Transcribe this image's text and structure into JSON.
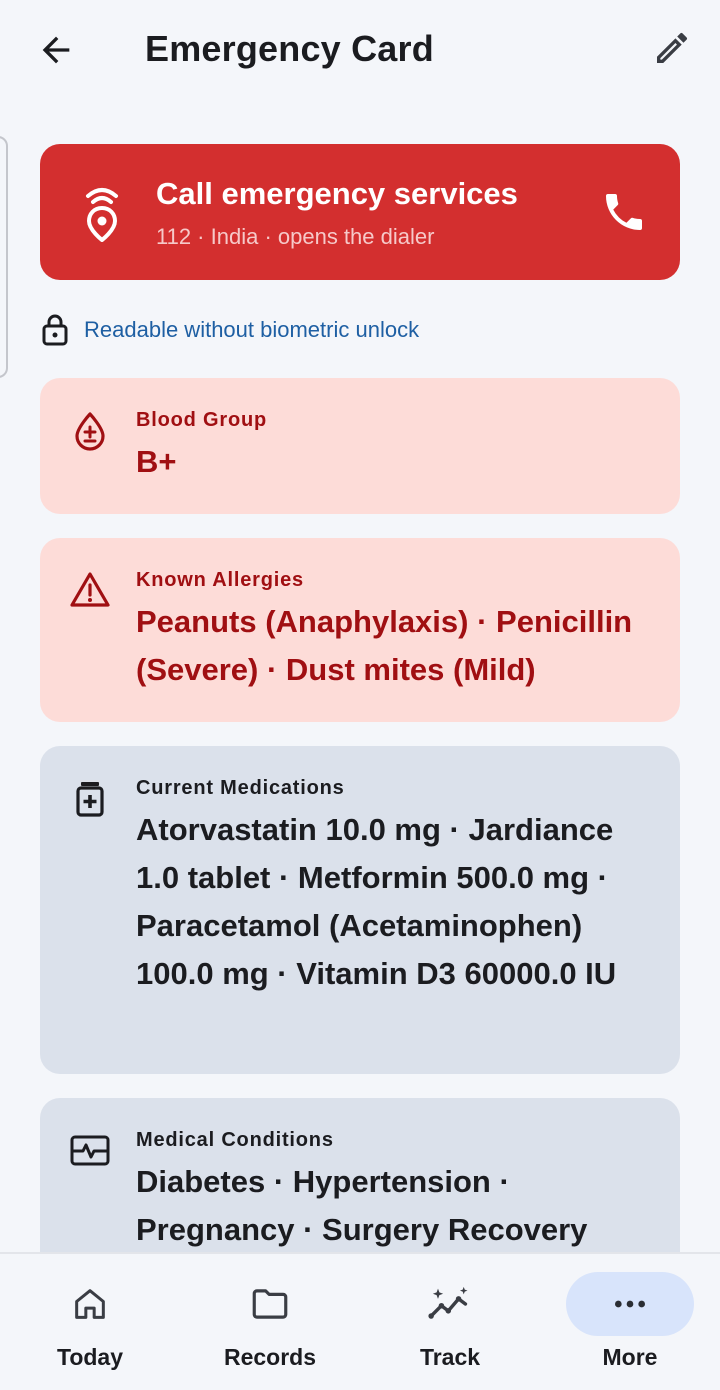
{
  "header": {
    "title": "Emergency Card"
  },
  "emergency_call": {
    "title": "Call emergency services",
    "subtitle": "112 · India · opens the dialer"
  },
  "notice": {
    "text": "Readable without biometric unlock"
  },
  "cards": {
    "blood_group": {
      "label": "Blood Group",
      "value": "B+"
    },
    "allergies": {
      "label": "Known Allergies",
      "value": "Peanuts (Anaphylaxis) · Penicillin (Severe) · Dust mites (Mild)"
    },
    "medications": {
      "label": "Current Medications",
      "value": "Atorvastatin 10.0 mg · Jardiance 1.0 tablet · Metformin 500.0 mg · Paracetamol (Acetaminophen) 100.0 mg · Vitamin D3 60000.0 IU"
    },
    "conditions": {
      "label": "Medical Conditions",
      "value": "Diabetes · Hypertension · Pregnancy · Surgery Recovery"
    }
  },
  "nav": {
    "items": [
      {
        "label": "Today",
        "icon": "home-icon"
      },
      {
        "label": "Records",
        "icon": "folder-icon"
      },
      {
        "label": "Track",
        "icon": "sparkle-chart-icon"
      },
      {
        "label": "More",
        "icon": "more-horizontal-icon",
        "active": true
      }
    ]
  },
  "colors": {
    "emergency_red": "#d32f2f",
    "alert_bg": "#fddcd8",
    "alert_text": "#a00f12",
    "neutral_bg": "#dbe1eb",
    "link_blue": "#1e5fa3",
    "nav_active_bg": "#d8e4fb"
  }
}
